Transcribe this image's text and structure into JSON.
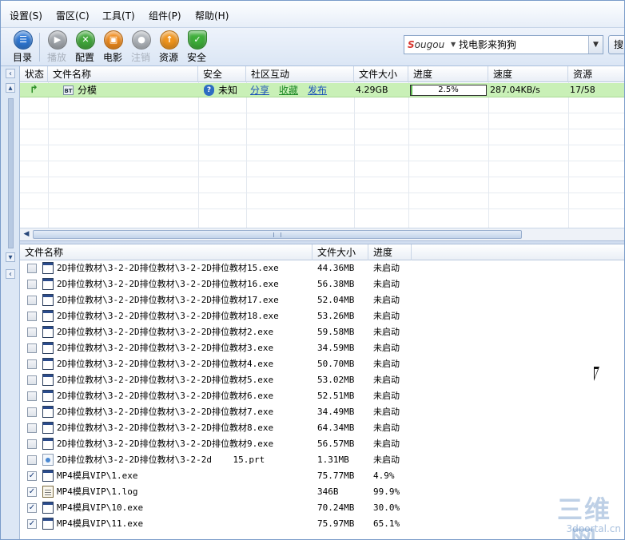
{
  "menu": [
    "设置(S)",
    "雷区(C)",
    "工具(T)",
    "组件(P)",
    "帮助(H)"
  ],
  "toolbar": [
    {
      "label": "目录",
      "icon": "folder-list-icon",
      "enabled": true
    },
    {
      "label": "播放",
      "icon": "camera-icon",
      "enabled": false
    },
    {
      "label": "配置",
      "icon": "tools-icon",
      "enabled": true
    },
    {
      "label": "电影",
      "icon": "movie-icon",
      "enabled": true
    },
    {
      "label": "注销",
      "icon": "user-icon",
      "enabled": false
    },
    {
      "label": "资源",
      "icon": "upload-icon",
      "enabled": true
    },
    {
      "label": "安全",
      "icon": "shield-icon",
      "enabled": true
    }
  ],
  "search": {
    "logo_prefix": "S",
    "logo_rest": "ougou",
    "text": "找电影来狗狗",
    "go_label": "搜"
  },
  "task_table": {
    "columns": [
      "状态",
      "文件名称",
      "安全",
      "社区互动",
      "文件大小",
      "进度",
      "速度",
      "资源"
    ],
    "row": {
      "name": "分模",
      "bt_badge": "BT",
      "safety": "未知",
      "share": "分享",
      "favorite": "收藏",
      "publish": "发布",
      "size": "4.29GB",
      "progress_text": "2.5%",
      "progress": 0.025,
      "speed": "287.04KB/s",
      "resources": "17/58"
    }
  },
  "file_table": {
    "columns": [
      "文件名称",
      "文件大小",
      "进度"
    ],
    "rows": [
      {
        "name": "2D排位教材\\3-2-2D排位教材\\3-2-2D排位教材15.exe",
        "size": "44.36MB",
        "progress": "未启动",
        "checked": false,
        "type": "exe"
      },
      {
        "name": "2D排位教材\\3-2-2D排位教材\\3-2-2D排位教材16.exe",
        "size": "56.38MB",
        "progress": "未启动",
        "checked": false,
        "type": "exe"
      },
      {
        "name": "2D排位教材\\3-2-2D排位教材\\3-2-2D排位教材17.exe",
        "size": "52.04MB",
        "progress": "未启动",
        "checked": false,
        "type": "exe"
      },
      {
        "name": "2D排位教材\\3-2-2D排位教材\\3-2-2D排位教材18.exe",
        "size": "53.26MB",
        "progress": "未启动",
        "checked": false,
        "type": "exe"
      },
      {
        "name": "2D排位教材\\3-2-2D排位教材\\3-2-2D排位教材2.exe",
        "size": "59.58MB",
        "progress": "未启动",
        "checked": false,
        "type": "exe"
      },
      {
        "name": "2D排位教材\\3-2-2D排位教材\\3-2-2D排位教材3.exe",
        "size": "34.59MB",
        "progress": "未启动",
        "checked": false,
        "type": "exe"
      },
      {
        "name": "2D排位教材\\3-2-2D排位教材\\3-2-2D排位教材4.exe",
        "size": "50.70MB",
        "progress": "未启动",
        "checked": false,
        "type": "exe"
      },
      {
        "name": "2D排位教材\\3-2-2D排位教材\\3-2-2D排位教材5.exe",
        "size": "53.02MB",
        "progress": "未启动",
        "checked": false,
        "type": "exe"
      },
      {
        "name": "2D排位教材\\3-2-2D排位教材\\3-2-2D排位教材6.exe",
        "size": "52.51MB",
        "progress": "未启动",
        "checked": false,
        "type": "exe"
      },
      {
        "name": "2D排位教材\\3-2-2D排位教材\\3-2-2D排位教材7.exe",
        "size": "34.49MB",
        "progress": "未启动",
        "checked": false,
        "type": "exe"
      },
      {
        "name": "2D排位教材\\3-2-2D排位教材\\3-2-2D排位教材8.exe",
        "size": "64.34MB",
        "progress": "未启动",
        "checked": false,
        "type": "exe"
      },
      {
        "name": "2D排位教材\\3-2-2D排位教材\\3-2-2D排位教材9.exe",
        "size": "56.57MB",
        "progress": "未启动",
        "checked": false,
        "type": "exe"
      },
      {
        "name": "2D排位教材\\3-2-2D排位教材\\3-2-2d    15.prt",
        "size": "1.31MB",
        "progress": "未启动",
        "checked": false,
        "type": "prt"
      },
      {
        "name": "MP4模具VIP\\1.exe",
        "size": "75.77MB",
        "progress": "4.9%",
        "checked": true,
        "type": "exe"
      },
      {
        "name": "MP4模具VIP\\1.log",
        "size": "346B",
        "progress": "99.9%",
        "checked": true,
        "type": "doc"
      },
      {
        "name": "MP4模具VIP\\10.exe",
        "size": "70.24MB",
        "progress": "30.0%",
        "checked": true,
        "type": "exe"
      },
      {
        "name": "MP4模具VIP\\11.exe",
        "size": "75.97MB",
        "progress": "65.1%",
        "checked": true,
        "type": "exe"
      }
    ]
  },
  "watermark": {
    "main": "三维网",
    "sub": "3dportal.cn"
  }
}
